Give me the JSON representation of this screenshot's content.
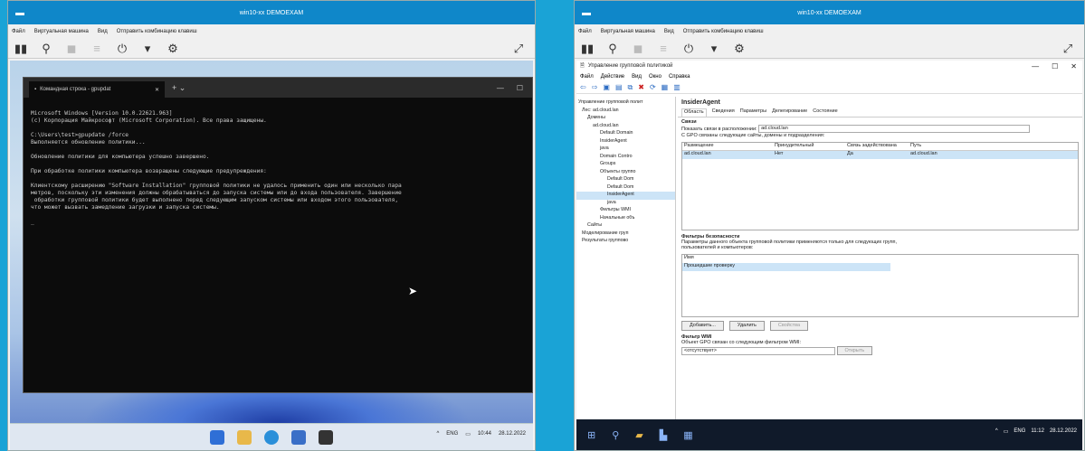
{
  "vm_left": {
    "title": "win10-xx DEMOEXAM",
    "menu": [
      "Файл",
      "Виртуальная машина",
      "Вид",
      "Отправить комбинацию клавиш"
    ],
    "terminal": {
      "tab_title": "Командная строка - gpupdat",
      "lines": [
        "Microsoft Windows [Version 10.0.22621.963]",
        "(c) Корпорация Майкрософт (Microsoft Corporation). Все права защищены.",
        "",
        "C:\\Users\\test>gpupdate /force",
        "Выполняется обновление политики...",
        "",
        "Обновление политики для компьютера успешно завершено.",
        "",
        "При обработке политики компьютера возвращены следующие предупреждения:",
        "",
        "Клиентскому расширению \"Software Installation\" групповой политики не удалось применить один или несколько пара",
        "метров, поскольку эти изменения должны обрабатываться до запуска системы или до входа пользователя. Завершение",
        " обработки групповой политики будет выполнено перед следующим запуском системы или входом этого пользователя,",
        "что может вызвать замедление загрузки и запуска системы.",
        "",
        "_"
      ]
    },
    "tray": {
      "lang": "ENG",
      "time": "10:44",
      "date": "28.12.2022"
    }
  },
  "vm_right": {
    "title": "win10-xx DEMOEXAM",
    "menu": [
      "Файл",
      "Виртуальная машина",
      "Вид",
      "Отправить комбинацию клавиш"
    ],
    "gpmc": {
      "title": "Управление групповой политикой",
      "menu": [
        "Файл",
        "Действие",
        "Вид",
        "Окно",
        "Справка"
      ],
      "tree": [
        "Управление групповой полит",
        "Лес: ad.cloud.lan",
        "Домены",
        "ad.cloud.lan",
        "Default Domain",
        "InsiderAgent",
        "java",
        "Domain Contro",
        "Groups",
        "Объекты группо",
        "Default Dom",
        "Default Dom",
        "InsiderAgent",
        "java",
        "Фильтры WMI",
        "Начальные объ",
        "Сайты",
        "Моделирование груп",
        "Результаты группово"
      ],
      "selected_tree_index": 12,
      "header": "InsiderAgent",
      "tabs": [
        "Область",
        "Сведения",
        "Параметры",
        "Делегирование",
        "Состояние"
      ],
      "links_label": "Связи",
      "show_links_label": "Показать связи в расположении:",
      "location_value": "ad.cloud.lan",
      "links_desc": "С GPO связаны следующие сайты, домены и подразделения:",
      "grid_headers": [
        "Размещение",
        "Принудительный",
        "Связь задействована",
        "Путь"
      ],
      "grid_row": [
        "ad.cloud.lan",
        "Нет",
        "Да",
        "ad.cloud.lan"
      ],
      "security_label": "Фильтры безопасности",
      "security_desc": "Параметры данного объекта групповой политики применяются только для следующих групп, пользователей и компьютеров:",
      "name_header": "Имя",
      "security_item": "Прошедшие проверку",
      "buttons": [
        "Добавить...",
        "Удалить",
        "Свойства"
      ],
      "wmi_label": "Фильтр WMI",
      "wmi_desc": "Объект GPO связан со следующим фильтром WMI:",
      "wmi_value": "<отсутствует>",
      "wmi_button": "Открыть"
    },
    "tray": {
      "lang": "ENG",
      "time": "11:12",
      "date": "28.12.2022"
    }
  }
}
